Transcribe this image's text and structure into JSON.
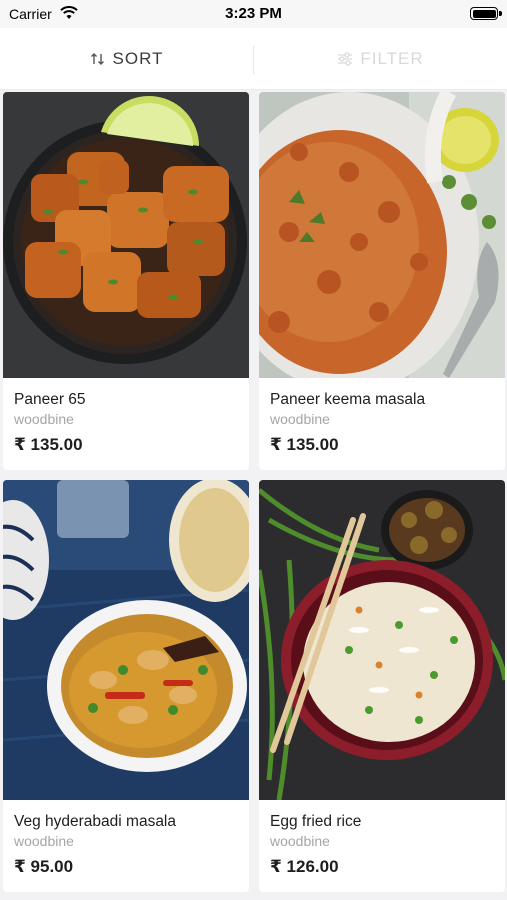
{
  "status_bar": {
    "carrier": "Carrier",
    "time": "3:23 PM"
  },
  "toolbar": {
    "sort_label": "SORT",
    "filter_label": "FILTER"
  },
  "products": [
    {
      "title": "Paneer 65",
      "store": "woodbine",
      "price": "₹ 135.00"
    },
    {
      "title": "Paneer keema masala",
      "store": "woodbine",
      "price": "₹ 135.00"
    },
    {
      "title": "Veg hyderabadi masala",
      "store": "woodbine",
      "price": "₹ 95.00"
    },
    {
      "title": "Egg fried rice",
      "store": "woodbine",
      "price": "₹ 126.00"
    }
  ],
  "colors": {
    "background": "#f2f2f4",
    "card": "#ffffff",
    "text": "#1e1e1e",
    "muted": "#a5a5a5",
    "filter_disabled": "#d9d9d9"
  }
}
